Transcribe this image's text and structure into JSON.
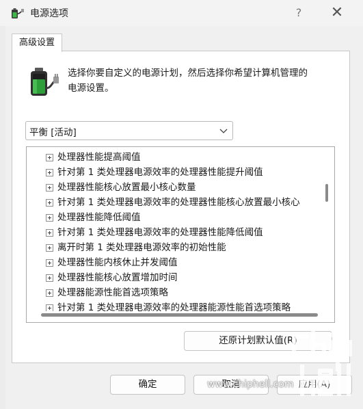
{
  "window": {
    "title": "电源选项",
    "help_glyph": "?",
    "close_glyph": "✕"
  },
  "tab": {
    "label": "高级设置"
  },
  "description": {
    "line1": "选择你要自定义的电源计划，然后选择你希望计算机管理的",
    "line2": "电源设置。"
  },
  "plan_select": {
    "value": "平衡 [活动]"
  },
  "tree": {
    "items": [
      "处理器性能提高阈值",
      "针对第 1 类处理器电源效率的处理器性能提升阈值",
      "处理器性能核心放置最小核心数量",
      "针对第 1 类处理器电源效率的处理器性能核心放置最小核心",
      "处理器性能降低阈值",
      "针对第 1 类处理器电源效率的处理器性能降低阈值",
      "离开时第 1 类处理器电源效率的初始性能",
      "处理器性能内核休止并发阈值",
      "处理器性能核心放置增加时间",
      "处理器能源性能首选项策略",
      "针对第 1 类处理器电源效率的处理器能源性能首选项策略"
    ]
  },
  "buttons": {
    "restore": "还原计划默认值(R)",
    "ok": "确定",
    "cancel": "取消",
    "apply": "应用(A)"
  },
  "watermark": {
    "url": "www.chiphell.com"
  },
  "colors": {
    "battery_green": "#2e9e3a",
    "watermark": "#ffffff"
  }
}
